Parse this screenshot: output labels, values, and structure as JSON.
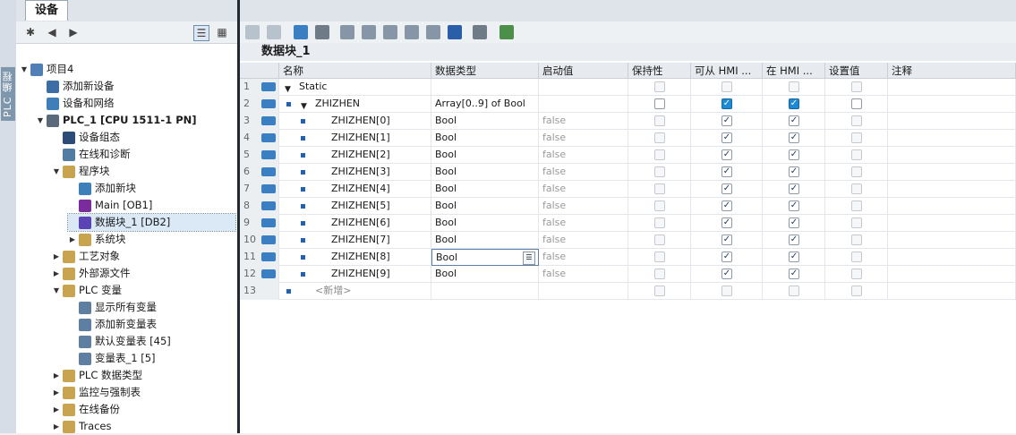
{
  "sidebar_label": "PLC 编程",
  "tree": {
    "tab": "设备",
    "items": [
      {
        "label": "项目4",
        "icon": "project-icon"
      },
      {
        "label": "添加新设备",
        "icon": "add-device-icon"
      },
      {
        "label": "设备和网络",
        "icon": "network-icon"
      },
      {
        "label": "PLC_1 [CPU 1511-1 PN]",
        "icon": "plc-icon"
      },
      {
        "label": "设备组态",
        "icon": "device-config-icon"
      },
      {
        "label": "在线和诊断",
        "icon": "online-diag-icon"
      },
      {
        "label": "程序块",
        "icon": "folder-icon"
      },
      {
        "label": "添加新块",
        "icon": "add-block-icon"
      },
      {
        "label": "Main [OB1]",
        "icon": "ob-icon"
      },
      {
        "label": "数据块_1 [DB2]",
        "icon": "db-icon"
      },
      {
        "label": "系统块",
        "icon": "folder-icon"
      },
      {
        "label": "工艺对象",
        "icon": "folder-icon"
      },
      {
        "label": "外部源文件",
        "icon": "folder-icon"
      },
      {
        "label": "PLC 变量",
        "icon": "folder-icon"
      },
      {
        "label": "显示所有变量",
        "icon": "tags-icon"
      },
      {
        "label": "添加新变量表",
        "icon": "add-table-icon"
      },
      {
        "label": "默认变量表 [45]",
        "icon": "table-icon"
      },
      {
        "label": "变量表_1 [5]",
        "icon": "table-icon"
      },
      {
        "label": "PLC 数据类型",
        "icon": "folder-icon"
      },
      {
        "label": "监控与强制表",
        "icon": "folder-icon"
      },
      {
        "label": "在线备份",
        "icon": "folder-icon"
      },
      {
        "label": "Traces",
        "icon": "folder-icon"
      }
    ]
  },
  "editor": {
    "title": "数据块_1",
    "columns": [
      "名称",
      "数据类型",
      "启动值",
      "保持性",
      "可从 HMI ...",
      "在 HMI ...",
      "设置值",
      "注释"
    ],
    "rows": [
      {
        "n": "1",
        "name": "Static",
        "type": "",
        "start": ""
      },
      {
        "n": "2",
        "name": "ZHIZHEN",
        "type": "Array[0..9] of Bool",
        "start": ""
      },
      {
        "n": "3",
        "name": "ZHIZHEN[0]",
        "type": "Bool",
        "start": "false"
      },
      {
        "n": "4",
        "name": "ZHIZHEN[1]",
        "type": "Bool",
        "start": "false"
      },
      {
        "n": "5",
        "name": "ZHIZHEN[2]",
        "type": "Bool",
        "start": "false"
      },
      {
        "n": "6",
        "name": "ZHIZHEN[3]",
        "type": "Bool",
        "start": "false"
      },
      {
        "n": "7",
        "name": "ZHIZHEN[4]",
        "type": "Bool",
        "start": "false"
      },
      {
        "n": "8",
        "name": "ZHIZHEN[5]",
        "type": "Bool",
        "start": "false"
      },
      {
        "n": "9",
        "name": "ZHIZHEN[6]",
        "type": "Bool",
        "start": "false"
      },
      {
        "n": "10",
        "name": "ZHIZHEN[7]",
        "type": "Bool",
        "start": "false"
      },
      {
        "n": "11",
        "name": "ZHIZHEN[8]",
        "type": "Bool",
        "start": "false"
      },
      {
        "n": "12",
        "name": "ZHIZHEN[9]",
        "type": "Bool",
        "start": "false"
      },
      {
        "n": "13",
        "name": "<新增>",
        "type": "",
        "start": ""
      }
    ]
  }
}
